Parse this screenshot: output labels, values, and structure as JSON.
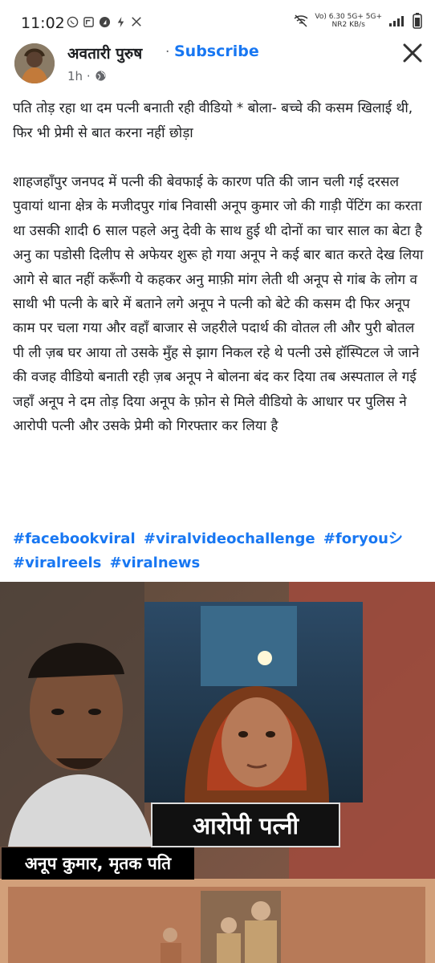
{
  "status_bar": {
    "time": "11:02",
    "net_top": "Vo) 6.30 5G+ 5G+",
    "net_bottom": "NR2 KB/s"
  },
  "header": {
    "name": "अवतारी पुरुष",
    "separator": "·",
    "subscribe": "Subscribe",
    "time": "1h",
    "sep2": "·"
  },
  "post": {
    "title_line": "पति  तोड़ रहा था दम पत्नी बनाती रही वीडियो * बोला- बच्चे की कसम खिलाई थी, फिर भी प्रेमी से बात करना नहीं छोड़ा",
    "body": "शाहजहाँपुर जनपद में पत्नी की बेवफाई के कारण पति की जान चली गई दरसल पुवायां थाना क्षेत्र के मजीदपुर गांब निवासी अनूप कुमार जो की गाड़ी पेंटिंग का करता था उसकी शादी 6 साल पहले अनु देवी के साथ हुई थी दोनों का चार साल का बेटा है अनु का पडोसी दिलीप से अफेयर शुरू हो गया अनूप ने कई बार बात करते देख लिया आगे से बात नहीं करूँगी ये कहकर अनु माफ़ी मांग लेती थी अनूप से गांब के लोग व साथी भी पत्नी के बारे में बताने लगे अनूप ने पत्नी को बेटे की कसम दी फिर अनूप काम पर चला गया और वहाँ बाजार से जहरीले पदार्थ की वोतल ली और पुरी बोतल पी ली ज़ब घर आया तो उसके मुँह से झाग निकल रहे थे पत्नी उसे हॉस्पिटल जे जाने की वजह वीडियो बनाती रही ज़ब अनूप ने बोलना बंद कर दिया तब अस्पताल  ले गई जहाँ अनूप ने दम तोड़ दिया अनूप के फ़ोन से मिले वीडियो के आधार पर पुलिस ने आरोपी पत्नी और उसके प्रेमी को गिरफ्तार कर लिया है",
    "hashtags": [
      "#facebookviral",
      "#viralvideochallenge",
      "#foryouシ",
      "#viralreels",
      "#viralnews"
    ]
  },
  "media": {
    "caption_wife": "आरोपी पत्नी",
    "caption_husband": "अनूप कुमार, मृतक पति"
  },
  "colors": {
    "link": "#1877f2",
    "text": "#1c1e21",
    "muted": "#65676b"
  }
}
